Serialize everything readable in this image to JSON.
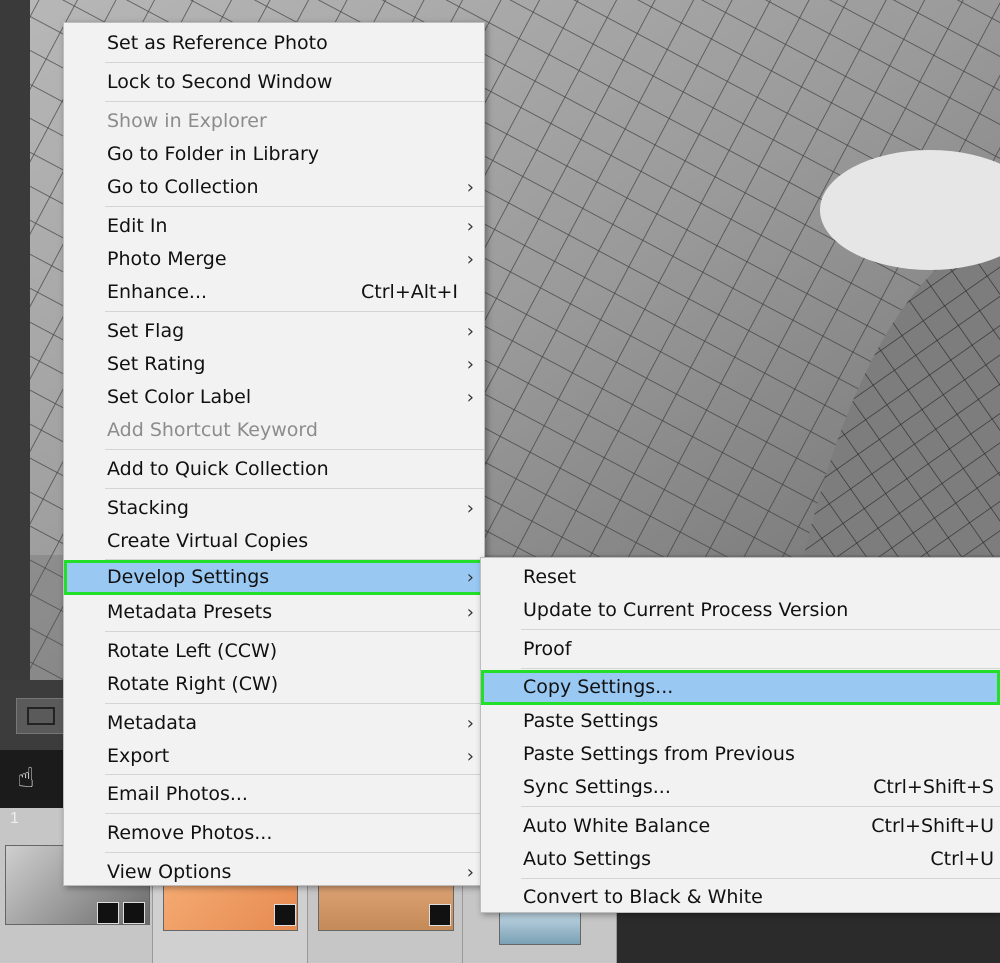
{
  "main_menu": {
    "items": [
      {
        "label": "Set as Reference Photo"
      },
      {
        "label": "Lock to Second Window"
      },
      {
        "label": "Show in Explorer"
      },
      {
        "label": "Go to Folder in Library"
      },
      {
        "label": "Go to Collection"
      },
      {
        "label": "Edit In"
      },
      {
        "label": "Photo Merge"
      },
      {
        "label": "Enhance...",
        "shortcut": "Ctrl+Alt+I"
      },
      {
        "label": "Set Flag"
      },
      {
        "label": "Set Rating"
      },
      {
        "label": "Set Color Label"
      },
      {
        "label": "Add Shortcut Keyword"
      },
      {
        "label": "Add to Quick Collection"
      },
      {
        "label": "Stacking"
      },
      {
        "label": "Create Virtual Copies"
      },
      {
        "label": "Develop Settings"
      },
      {
        "label": "Metadata Presets"
      },
      {
        "label": "Rotate Left (CCW)"
      },
      {
        "label": "Rotate Right (CW)"
      },
      {
        "label": "Metadata"
      },
      {
        "label": "Export"
      },
      {
        "label": "Email Photos..."
      },
      {
        "label": "Remove Photos..."
      },
      {
        "label": "View Options"
      }
    ]
  },
  "sub_menu": {
    "items": [
      {
        "label": "Reset"
      },
      {
        "label": "Update to Current Process Version"
      },
      {
        "label": "Proof"
      },
      {
        "label": "Copy Settings..."
      },
      {
        "label": "Paste Settings"
      },
      {
        "label": "Paste Settings from Previous"
      },
      {
        "label": "Sync Settings...",
        "shortcut": "Ctrl+Shift+S"
      },
      {
        "label": "Auto White Balance",
        "shortcut": "Ctrl+Shift+U"
      },
      {
        "label": "Auto Settings",
        "shortcut": "Ctrl+U"
      },
      {
        "label": "Convert to Black & White"
      }
    ]
  },
  "submenu_arrow": "›",
  "filmstrip": {
    "first_number": "1"
  },
  "colors": {
    "highlight": "#99c9f3",
    "focus_outline": "#22e02a",
    "disabled_text": "#8c8c8c"
  }
}
